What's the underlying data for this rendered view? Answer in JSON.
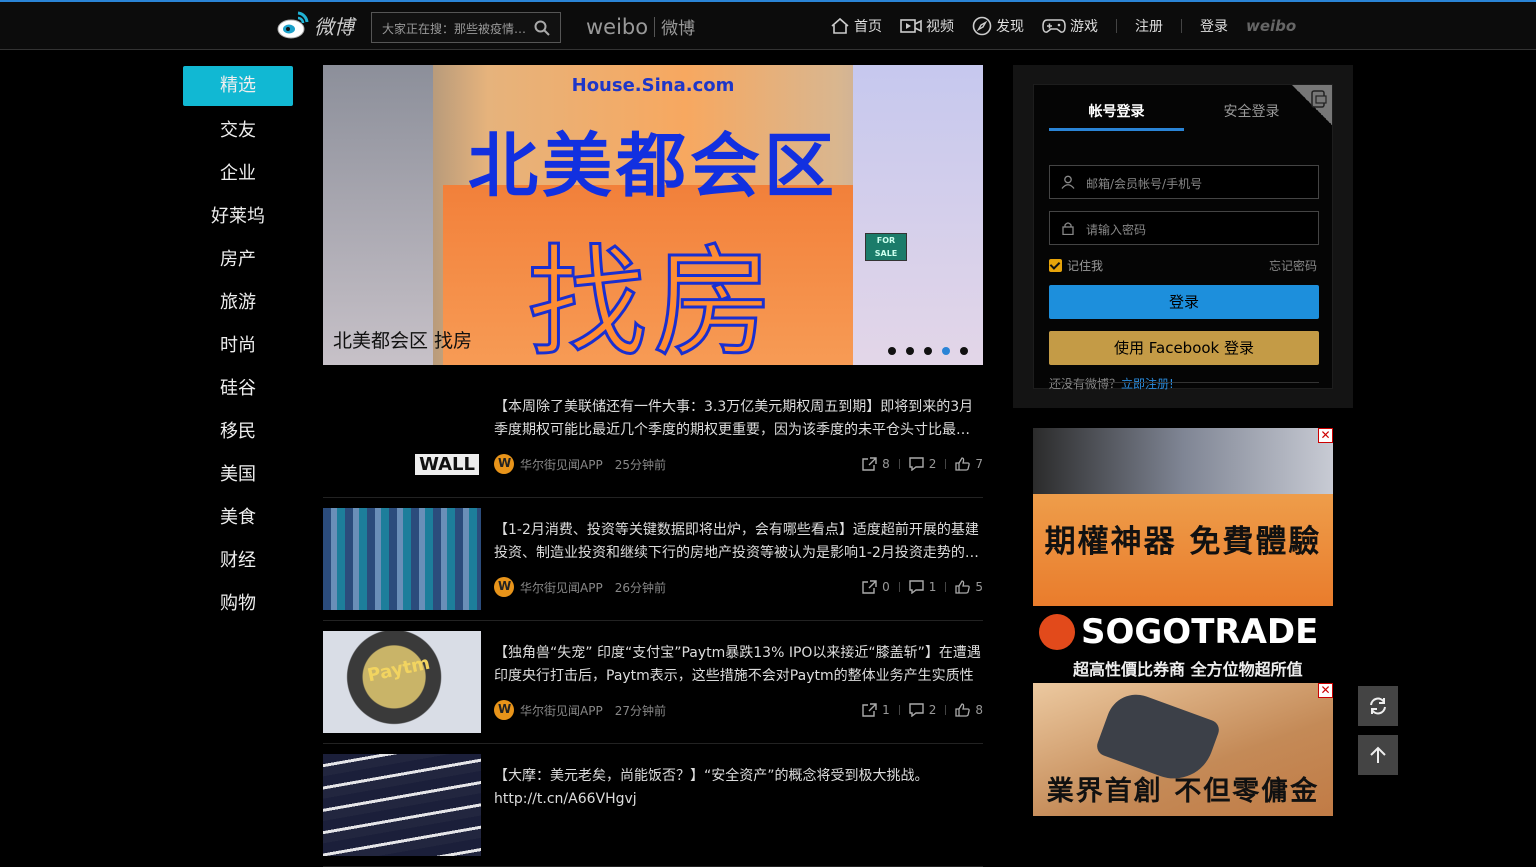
{
  "header": {
    "logo_text": "微博",
    "search_placeholder": "大家正在搜：那些被疫情…",
    "brand_en": "weibo",
    "brand_cn": "微博",
    "nav": [
      {
        "label": "首页",
        "icon": "home-icon"
      },
      {
        "label": "视频",
        "icon": "video-icon"
      },
      {
        "label": "发现",
        "icon": "discover-icon"
      },
      {
        "label": "游戏",
        "icon": "game-icon"
      }
    ],
    "register": "注册",
    "login": "登录",
    "weibo_small": "weibo"
  },
  "sidebar": {
    "items": [
      "精选",
      "交友",
      "企业",
      "好莱坞",
      "房产",
      "旅游",
      "时尚",
      "硅谷",
      "移民",
      "美国",
      "美食",
      "财经",
      "购物"
    ],
    "active_index": 0
  },
  "banner": {
    "site": "House.Sina.com",
    "headline": "北美都会区",
    "headline2": "找房",
    "forsale": "FOR SALE",
    "caption": "北美都会区 找房",
    "dot_count": 5,
    "active_dot": 3
  },
  "feed": [
    {
      "text": "【本周除了美联储还有一件大事：3.3万亿美元期权周五到期】即将到来的3月季度期权可能比最近几个季度的期权更重要，因为该季度的未平仓头寸比最…",
      "source": "华尔街见闻APP",
      "time": "25分钟前",
      "forward": "8",
      "comment": "2",
      "like": "7"
    },
    {
      "text": "【1-2月消费、投资等关键数据即将出炉，会有哪些看点】适度超前开展的基建投资、制造业投资和继续下行的房地产投资等被认为是影响1-2月投资走势的…",
      "source": "华尔街见闻APP",
      "time": "26分钟前",
      "forward": "0",
      "comment": "1",
      "like": "5"
    },
    {
      "text": "【独角兽“失宠” 印度“支付宝”Paytm暴跌13% IPO以来接近“膝盖斩”】在遭遇印度央行打击后，Paytm表示，这些措施不会对Paytm的整体业务产生实质性的…",
      "source": "华尔街见闻APP",
      "time": "27分钟前",
      "forward": "1",
      "comment": "2",
      "like": "8"
    },
    {
      "text": "【大摩：美元老矣，尚能饭否？】“安全资产”的概念将受到极大挑战。 http://t.cn/A66VHgvj"
    }
  ],
  "login": {
    "tab_account": "帐号登录",
    "tab_secure": "安全登录",
    "username_placeholder": "邮箱/会员帐号/手机号",
    "password_placeholder": "请输入密码",
    "remember": "记住我",
    "forgot": "忘记密码",
    "login_button": "登录",
    "facebook_button": "使用 Facebook 登录",
    "no_account": "还没有微博？",
    "register_link": "立即注册!"
  },
  "ads": {
    "ad1_headline": "期權神器 免費體驗",
    "ad1_brand": "SOGOTRADE",
    "ad1_tagline": "超高性價比券商 全方位物超所值",
    "ad2_headline": "業界首創 不但零傭金",
    "close": "✕"
  },
  "colors": {
    "accent": "#2a84d6",
    "active_tab": "#11b8d3",
    "facebook_btn": "#c49b46"
  }
}
